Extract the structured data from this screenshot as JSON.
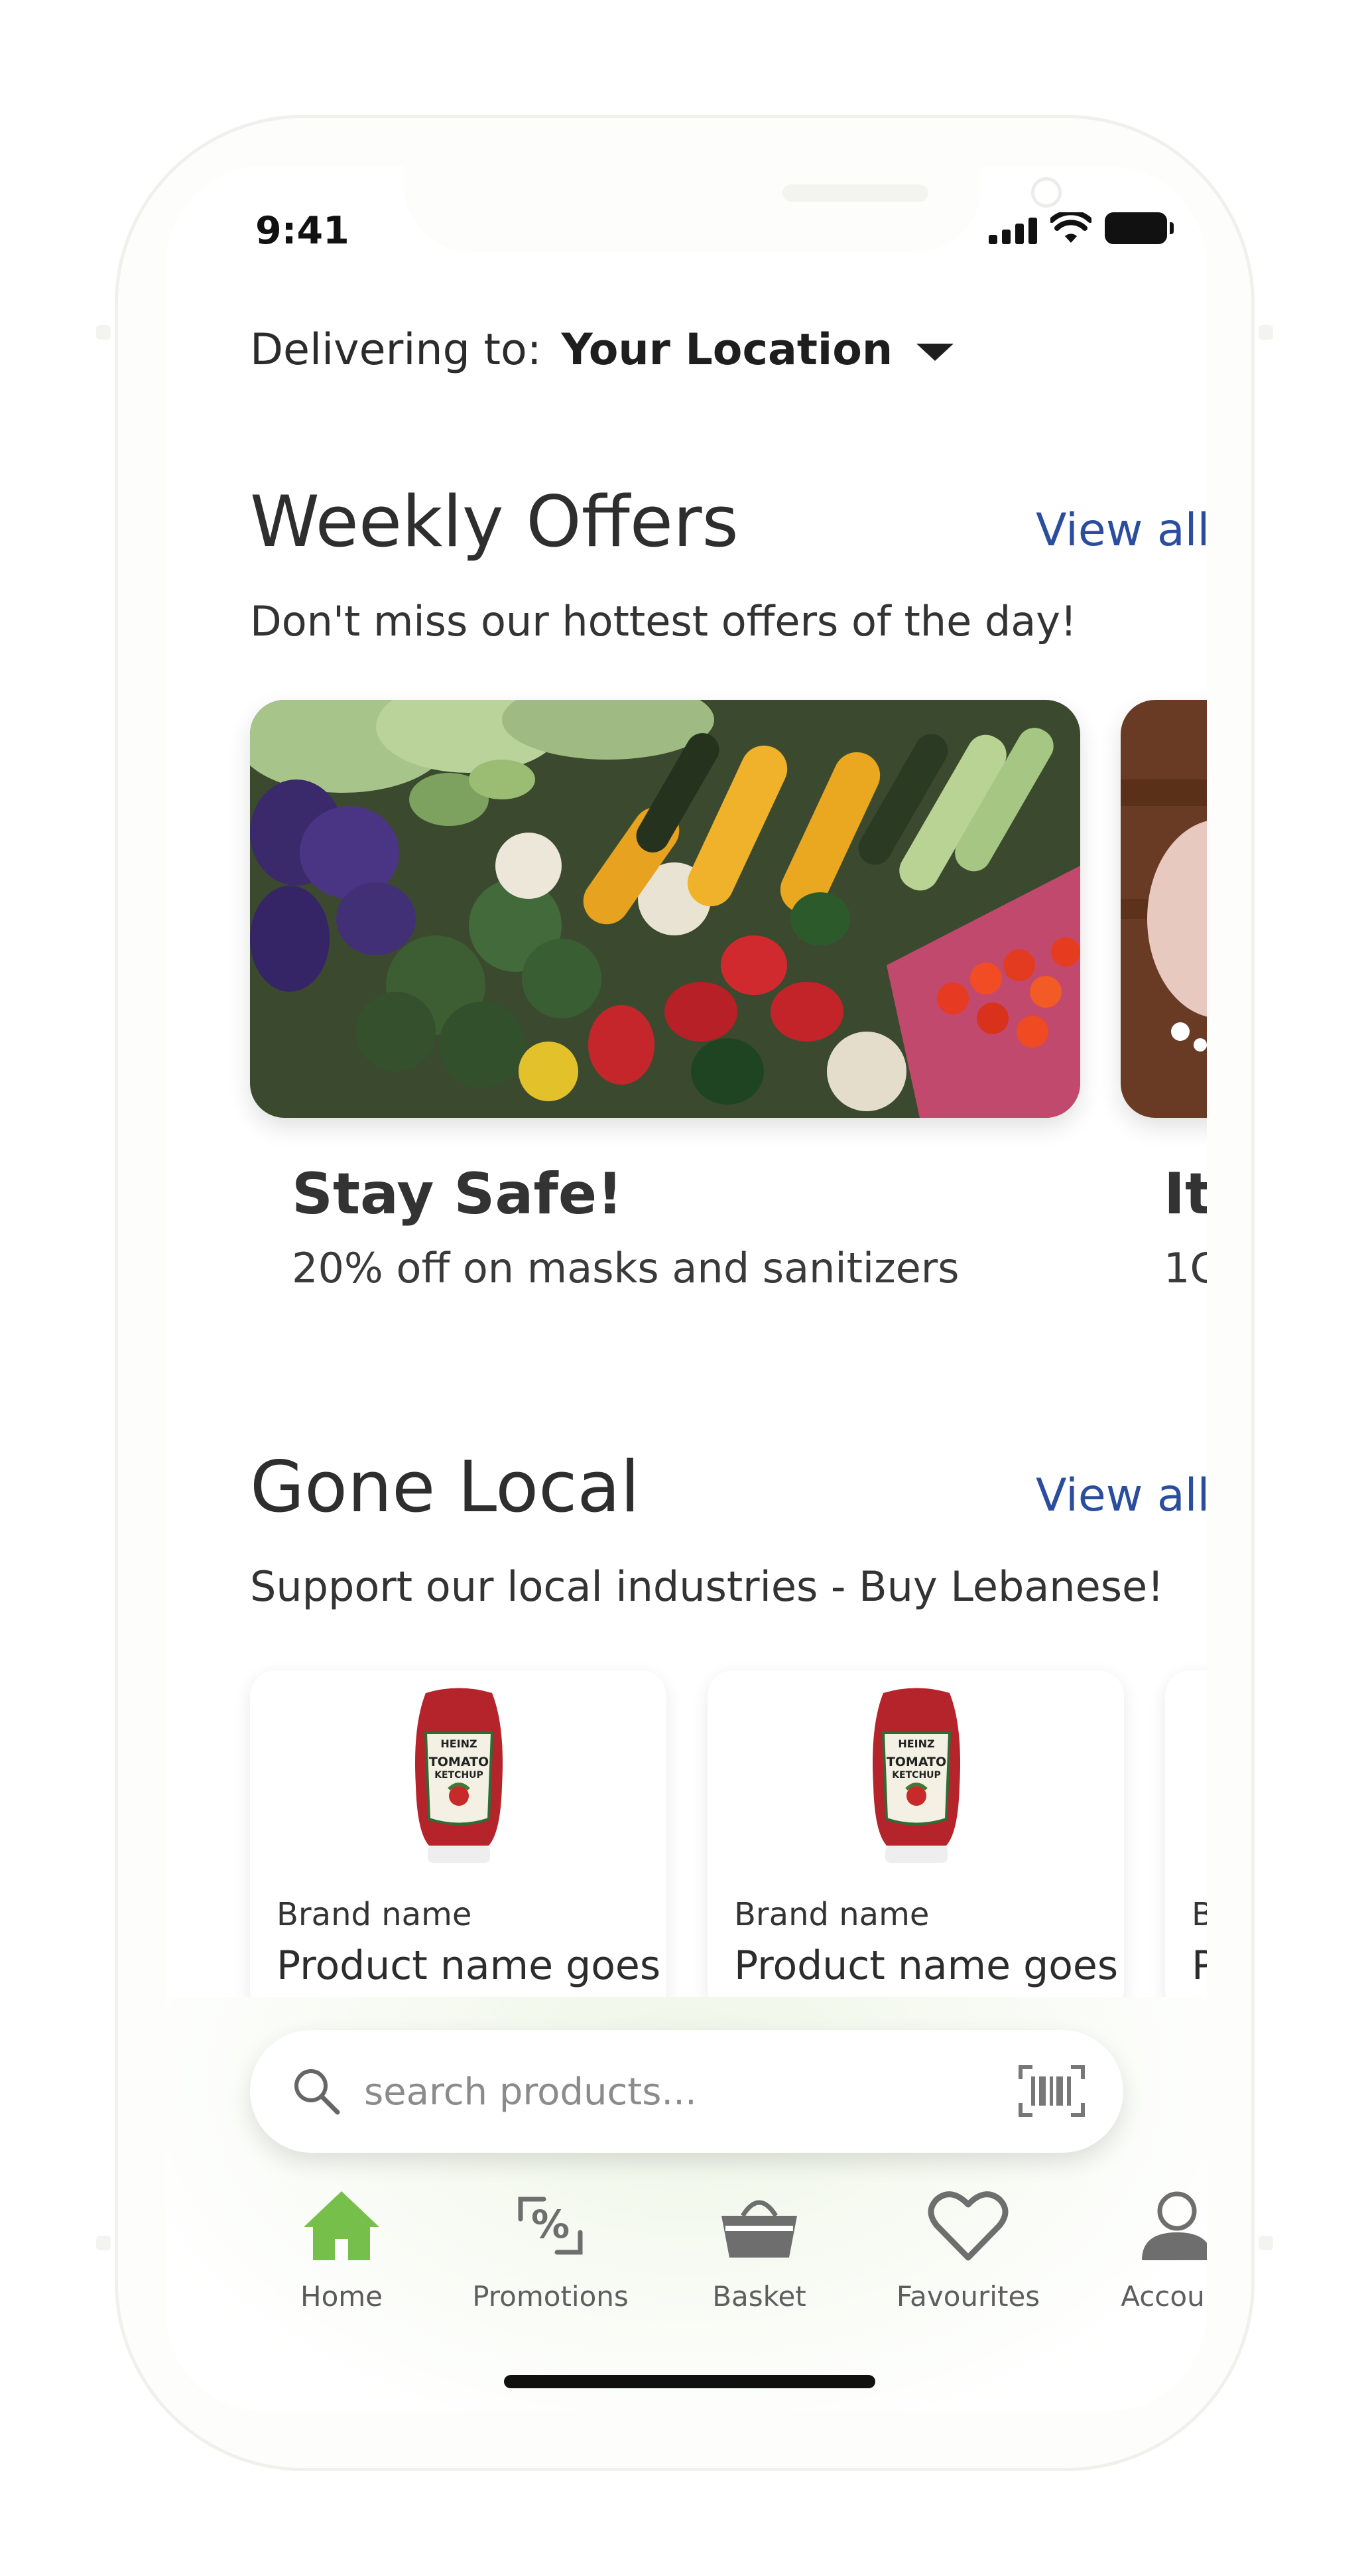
{
  "status_bar": {
    "time": "9:41"
  },
  "delivery": {
    "label": "Delivering to:",
    "location": "Your Location"
  },
  "weekly_offers": {
    "title": "Weekly Offers",
    "view_all": "View all",
    "subtitle": "Don't miss our hottest offers of the day!",
    "cards": [
      {
        "title": "Stay Safe!",
        "description": "20% off on masks and sanitizers"
      },
      {
        "title": "It'",
        "description": "1C"
      }
    ]
  },
  "gone_local": {
    "title": "Gone Local",
    "view_all": "View all",
    "subtitle": "Support our local industries - Buy Lebanese!",
    "products": [
      {
        "brand": "Brand name",
        "name": "Product name goes",
        "label_top": "HEINZ",
        "label_main": "TOMATO",
        "label_sub": "KETCHUP"
      },
      {
        "brand": "Brand name",
        "name": "Product name goes",
        "label_top": "HEINZ",
        "label_main": "TOMATO",
        "label_sub": "KETCHUP"
      },
      {
        "brand": "B",
        "name": "P"
      }
    ]
  },
  "search": {
    "placeholder": "search products..."
  },
  "tabs": [
    {
      "label": "Home",
      "icon": "home-icon",
      "active": true
    },
    {
      "label": "Promotions",
      "icon": "promotions-icon",
      "active": false
    },
    {
      "label": "Basket",
      "icon": "basket-icon",
      "active": false
    },
    {
      "label": "Favourites",
      "icon": "heart-icon",
      "active": false
    },
    {
      "label": "Account",
      "icon": "account-icon",
      "active": false
    }
  ],
  "colors": {
    "accent_green": "#76bf4b",
    "link_blue": "#2b4d9e",
    "icon_gray": "#6e6e6e"
  }
}
